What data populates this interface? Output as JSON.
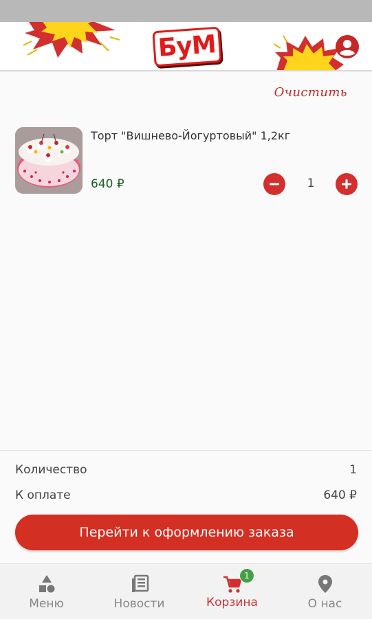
{
  "app": {
    "logo_text": "БуМ"
  },
  "cart": {
    "clear_label": "Очистить",
    "items": [
      {
        "title": "Торт \"Вишнево-Йогуртовый\" 1,2кг",
        "price": "640 ₽",
        "quantity": "1",
        "image_icon": "cake-photo"
      }
    ]
  },
  "summary": {
    "quantity_label": "Количество",
    "quantity_value": "1",
    "pay_label": "К оплате",
    "pay_value": "640 ₽",
    "checkout_label": "Перейти к оформлению заказа"
  },
  "nav": {
    "items": [
      {
        "label": "Меню",
        "icon": "menu-shapes-icon"
      },
      {
        "label": "Новости",
        "icon": "news-icon"
      },
      {
        "label": "Корзина",
        "icon": "cart-icon",
        "badge": "1",
        "active": true
      },
      {
        "label": "О нас",
        "icon": "location-pin-icon"
      }
    ]
  },
  "colors": {
    "accent_red": "#d32f2f",
    "price_green": "#1b5e20",
    "badge_green": "#43a047"
  }
}
